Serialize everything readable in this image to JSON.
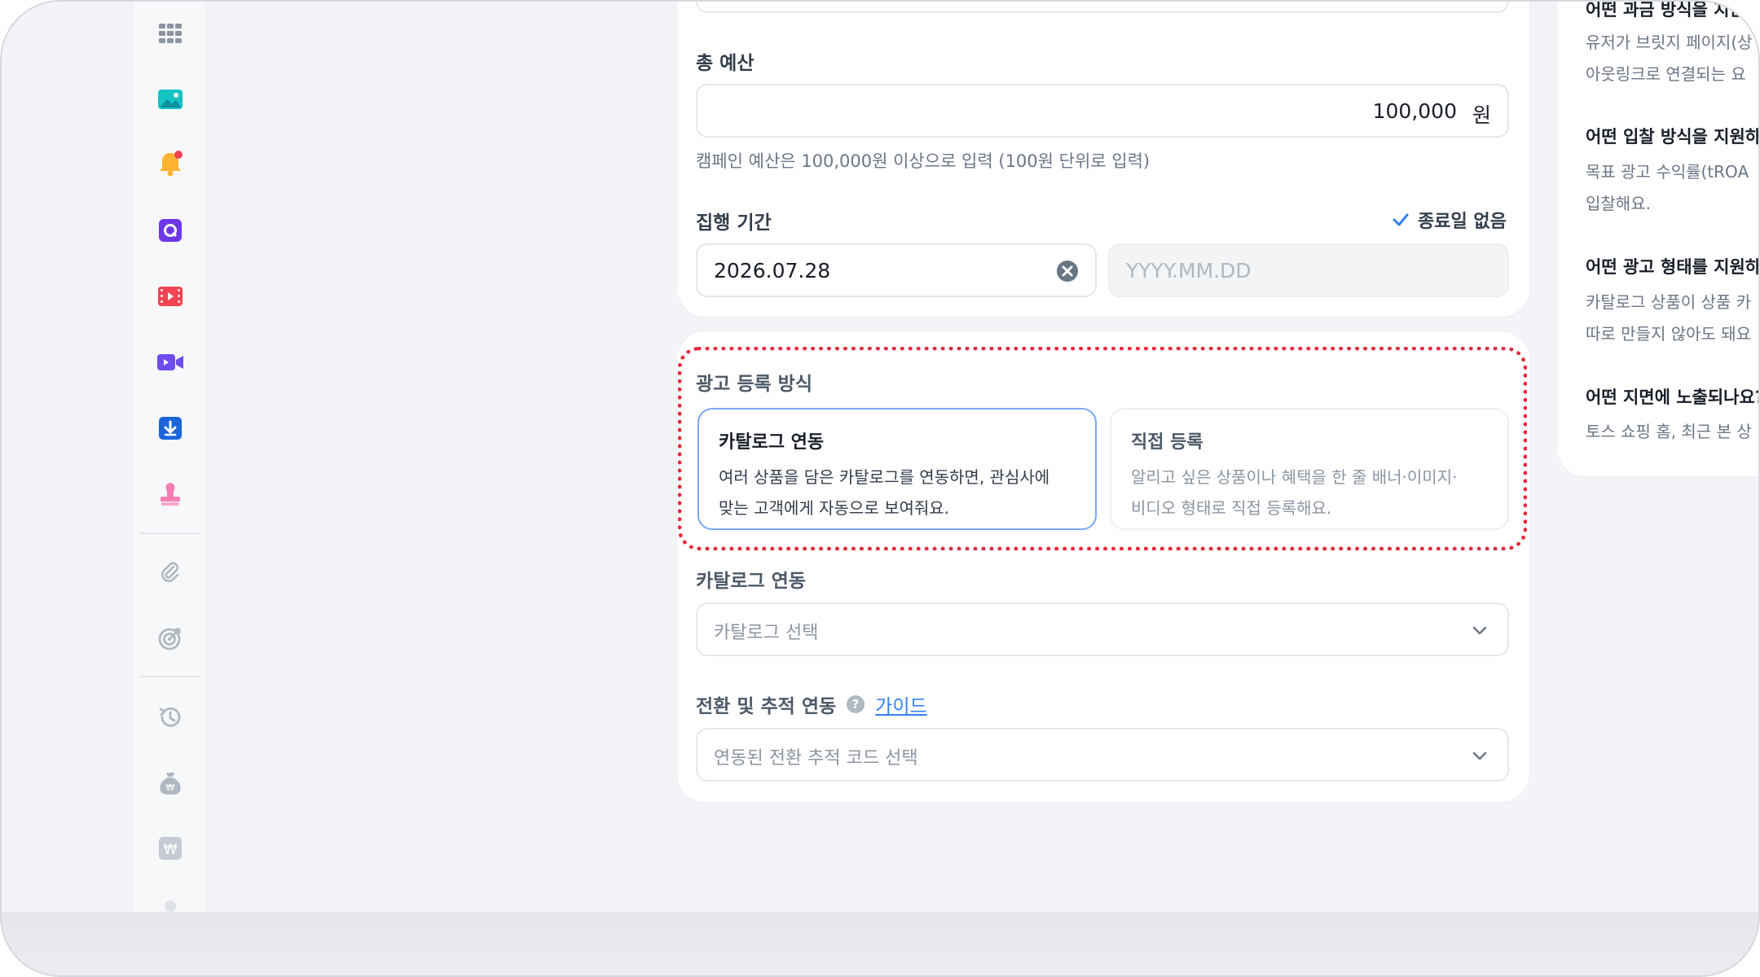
{
  "budget": {
    "label": "총 예산",
    "value": "100,000",
    "unit": "원",
    "helper": "캠페인 예산은 100,000원 이상으로 입력 (100원 단위로 입력)"
  },
  "period": {
    "label": "집행 기간",
    "no_end_label": "종료일 없음",
    "no_end_checked": true,
    "start_value": "2026.07.28",
    "end_placeholder": "YYYY.MM.DD"
  },
  "registration": {
    "label": "광고 등록 방식",
    "options": [
      {
        "title": "카탈로그 연동",
        "desc_line1": "여러 상품을 담은 카탈로그를 연동하면, 관심사에",
        "desc_line2": "맞는 고객에게 자동으로 보여줘요.",
        "selected": true
      },
      {
        "title": "직접 등록",
        "desc_line1": "알리고 싶은 상품이나 혜택을 한 줄 배너·이미지·",
        "desc_line2": "비디오 형태로 직접 등록해요.",
        "selected": false
      }
    ]
  },
  "catalog": {
    "label": "카탈로그 연동",
    "placeholder": "카탈로그 선택"
  },
  "conversion": {
    "label": "전환 및 추적 연동",
    "guide_link": "가이드",
    "placeholder": "연동된 전환 추적 코드 선택"
  },
  "faq": [
    {
      "q": "어떤 과금 방식을 지원",
      "a1": "유저가 브릿지 페이지(상",
      "a2": "아웃링크로 연결되는 요"
    },
    {
      "q": "어떤 입찰 방식을 지원하",
      "a1": "목표 광고 수익률(tROA",
      "a2": "입찰해요."
    },
    {
      "q": "어떤 광고 형태를 지원하",
      "a1": "카탈로그 상품이 상품 카",
      "a2": "따로 만들지 않아도 돼요"
    },
    {
      "q": "어떤 지면에 노출되나요?",
      "a1": "토스 쇼핑 홈, 최근 본 상"
    }
  ],
  "sidebar_icons": [
    "apps-grid-icon",
    "image-icon",
    "bell-icon",
    "q-app-icon",
    "video-reel-icon",
    "video-camera-icon",
    "download-icon",
    "stamp-icon",
    "attachment-icon",
    "target-icon",
    "history-icon",
    "money-bag-icon",
    "won-icon"
  ],
  "colors": {
    "accent": "#3182f6",
    "selected_border": "#7aa8f7",
    "highlight_dotted": "#e8283a",
    "notification_dot": "#f04452"
  }
}
